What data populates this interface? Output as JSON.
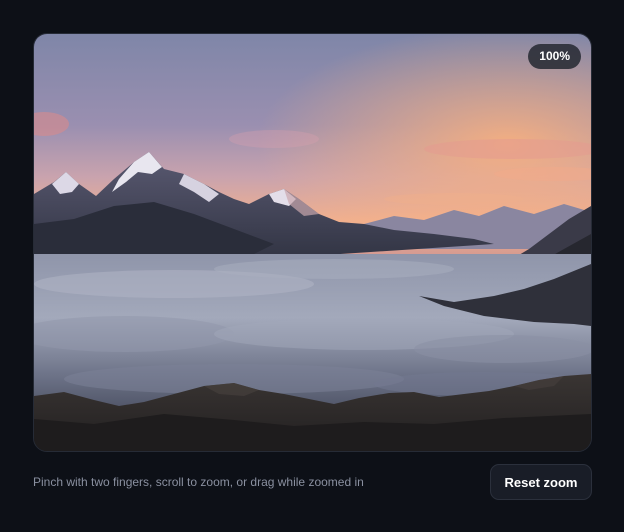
{
  "viewer": {
    "zoom_label": "100%",
    "image_subject": "mountain-sunset-sea-of-clouds"
  },
  "footer": {
    "hint": "Pinch with two fingers, scroll to zoom, or drag while zoomed in",
    "reset_label": "Reset zoom"
  },
  "colors": {
    "page_bg": "#0d1017",
    "button_bg": "#191d27",
    "hint_text": "#8a90a0"
  }
}
